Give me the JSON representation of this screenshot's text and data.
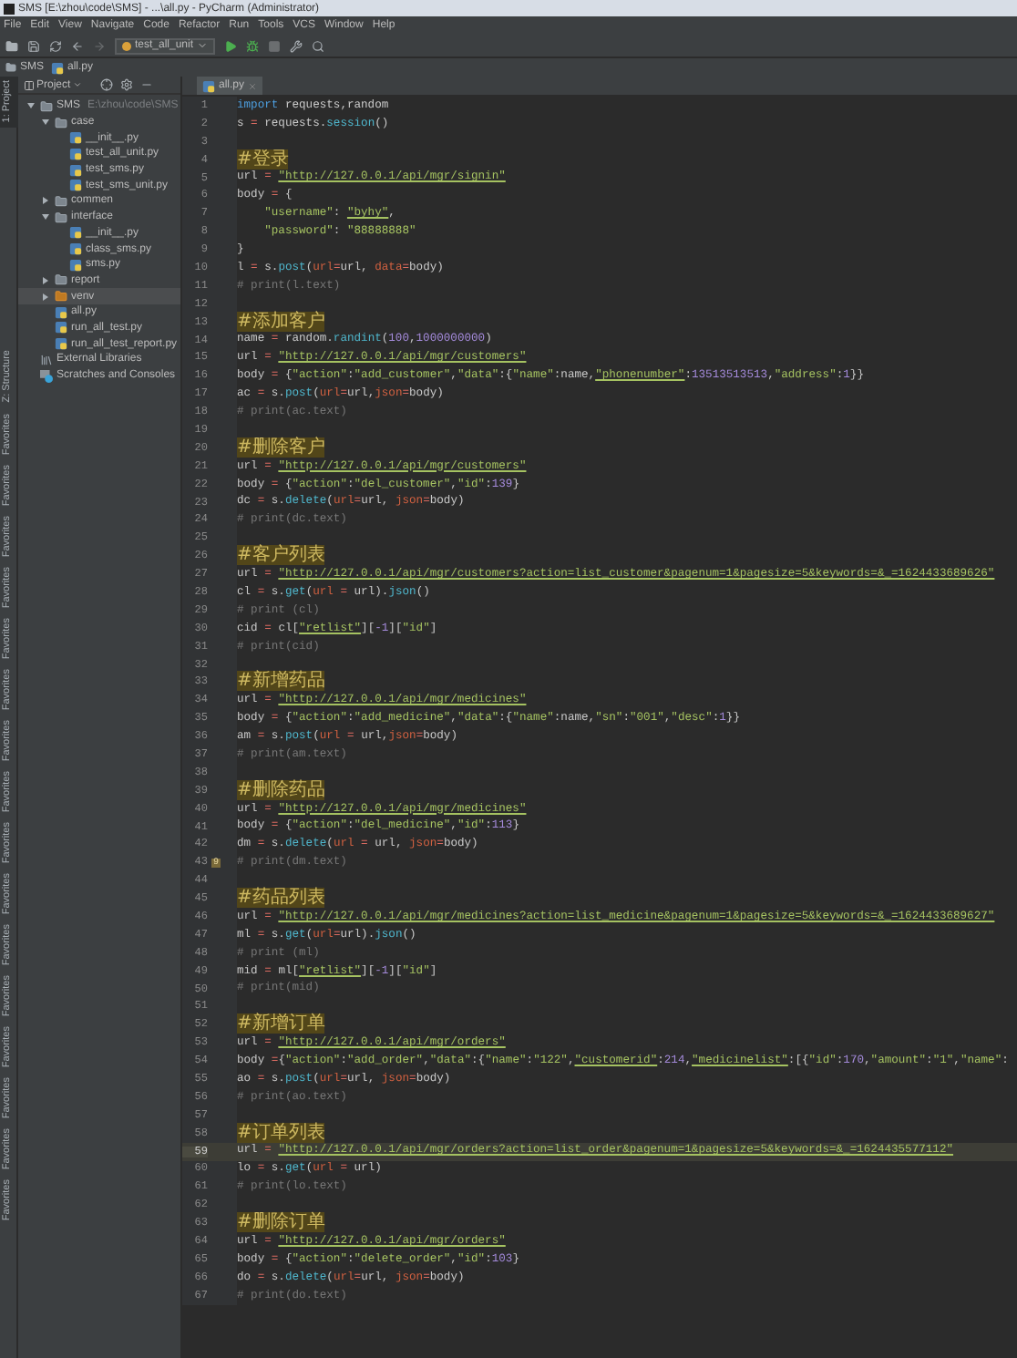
{
  "window": {
    "title": "SMS [E:\\zhou\\code\\SMS] - ...\\all.py - PyCharm (Administrator)"
  },
  "menu": [
    "File",
    "Edit",
    "View",
    "Navigate",
    "Code",
    "Refactor",
    "Run",
    "Tools",
    "VCS",
    "Window",
    "Help"
  ],
  "toolbar": {
    "run_config": "test_all_unit"
  },
  "breadcrumb": [
    "SMS",
    "all.py"
  ],
  "side_strip": [
    {
      "label": "1: Project",
      "selected": true
    },
    {
      "label": "Z: Structure",
      "selected": false
    },
    {
      "label": "Favorites",
      "selected": false
    },
    {
      "label": "Favorites",
      "selected": false
    },
    {
      "label": "Favorites",
      "selected": false
    },
    {
      "label": "Favorites",
      "selected": false
    },
    {
      "label": "Favorites",
      "selected": false
    },
    {
      "label": "Favorites",
      "selected": false
    },
    {
      "label": "Favorites",
      "selected": false
    },
    {
      "label": "Favorites",
      "selected": false
    },
    {
      "label": "Favorites",
      "selected": false
    },
    {
      "label": "Favorites",
      "selected": false
    },
    {
      "label": "Favorites",
      "selected": false
    },
    {
      "label": "Favorites",
      "selected": false
    },
    {
      "label": "Favorites",
      "selected": false
    },
    {
      "label": "Favorites",
      "selected": false
    },
    {
      "label": "Favorites",
      "selected": false
    },
    {
      "label": "Favorites",
      "selected": false
    }
  ],
  "project": {
    "title": "Project",
    "tree": [
      {
        "kind": "folder",
        "label": "SMS",
        "path": "E:\\zhou\\code\\SMS",
        "expanded": true,
        "selected": false,
        "children": [
          {
            "kind": "folder",
            "label": "case",
            "expanded": true,
            "selected": false,
            "children": [
              {
                "kind": "file",
                "label": "__init__.py",
                "selected": false
              },
              {
                "kind": "file",
                "label": "test_all_unit.py",
                "selected": false
              },
              {
                "kind": "file",
                "label": "test_sms.py",
                "selected": false
              },
              {
                "kind": "file",
                "label": "test_sms_unit.py",
                "selected": false
              }
            ]
          },
          {
            "kind": "folder",
            "label": "commen",
            "expanded": false,
            "selected": false
          },
          {
            "kind": "folder",
            "label": "interface",
            "expanded": true,
            "selected": false,
            "children": [
              {
                "kind": "file",
                "label": "__init__.py",
                "selected": false
              },
              {
                "kind": "file",
                "label": "class_sms.py",
                "selected": false
              },
              {
                "kind": "file",
                "label": "sms.py",
                "selected": false
              }
            ]
          },
          {
            "kind": "folder",
            "label": "report",
            "expanded": false,
            "selected": false
          },
          {
            "kind": "venv",
            "label": "venv",
            "expanded": false,
            "selected": true
          },
          {
            "kind": "file",
            "label": "all.py",
            "selected": false
          },
          {
            "kind": "file",
            "label": "run_all_test.py",
            "selected": false
          },
          {
            "kind": "file",
            "label": "run_all_test_report.py",
            "selected": false
          }
        ]
      },
      {
        "kind": "library",
        "label": "External Libraries",
        "selected": false
      },
      {
        "kind": "scratch",
        "label": "Scratches and Consoles",
        "selected": false
      }
    ]
  },
  "editor": {
    "tabs": [
      {
        "label": "all.py",
        "selected": true
      }
    ],
    "lines": [
      {
        "number": "1",
        "current": false,
        "tokens": [
          {
            "kind": "kw",
            "text": "import"
          },
          {
            "kind": "txt",
            "text": " requests,random"
          }
        ]
      },
      {
        "number": "2",
        "current": false,
        "tokens": [
          {
            "kind": "txt",
            "text": "s"
          },
          {
            "kind": "op",
            "text": " = "
          },
          {
            "kind": "txt",
            "text": "requests."
          },
          {
            "kind": "fn",
            "text": "session"
          },
          {
            "kind": "txt",
            "text": "()"
          }
        ]
      },
      {
        "number": "3",
        "current": false
      },
      {
        "number": "4",
        "current": false,
        "tokens": [
          {
            "kind": "head",
            "text": "#登录"
          }
        ]
      },
      {
        "number": "5",
        "current": false,
        "tokens": [
          {
            "kind": "txt",
            "text": "url"
          },
          {
            "kind": "op",
            "text": " = "
          },
          {
            "kind": "url",
            "text": "\"http://127.0.0.1/api/mgr/signin\""
          }
        ]
      },
      {
        "number": "6",
        "current": false,
        "tokens": [
          {
            "kind": "txt",
            "text": "body"
          },
          {
            "kind": "op",
            "text": " = "
          },
          {
            "kind": "txt",
            "text": "{"
          }
        ]
      },
      {
        "number": "7",
        "current": false,
        "tokens": [
          {
            "kind": "str",
            "text": "    \"username\""
          },
          {
            "kind": "txt",
            "text": ": "
          },
          {
            "kind": "url",
            "text": "\"byhy\""
          },
          {
            "kind": "txt",
            "text": ","
          }
        ]
      },
      {
        "number": "8",
        "current": false,
        "tokens": [
          {
            "kind": "str",
            "text": "    \"password\""
          },
          {
            "kind": "txt",
            "text": ": "
          },
          {
            "kind": "str",
            "text": "\"88888888\""
          }
        ]
      },
      {
        "number": "9",
        "current": false,
        "tokens": [
          {
            "kind": "txt",
            "text": "}"
          }
        ]
      },
      {
        "number": "10",
        "current": false,
        "tokens": [
          {
            "kind": "txt",
            "text": "l"
          },
          {
            "kind": "op",
            "text": " = "
          },
          {
            "kind": "txt",
            "text": "s."
          },
          {
            "kind": "fn",
            "text": "post"
          },
          {
            "kind": "txt",
            "text": "("
          },
          {
            "kind": "param",
            "text": "url"
          },
          {
            "kind": "op",
            "text": "="
          },
          {
            "kind": "txt",
            "text": "url, "
          },
          {
            "kind": "param",
            "text": "data"
          },
          {
            "kind": "op",
            "text": "="
          },
          {
            "kind": "txt",
            "text": "body)"
          }
        ]
      },
      {
        "number": "11",
        "current": false,
        "tokens": [
          {
            "kind": "cmt",
            "text": "# print(l.text)"
          }
        ]
      },
      {
        "number": "12",
        "current": false
      },
      {
        "number": "13",
        "current": false,
        "tokens": [
          {
            "kind": "head",
            "text": "#添加客户"
          }
        ]
      },
      {
        "number": "14",
        "current": false,
        "tokens": [
          {
            "kind": "txt",
            "text": "name"
          },
          {
            "kind": "op",
            "text": " = "
          },
          {
            "kind": "txt",
            "text": "random."
          },
          {
            "kind": "fn",
            "text": "randint"
          },
          {
            "kind": "txt",
            "text": "("
          },
          {
            "kind": "num",
            "text": "100"
          },
          {
            "kind": "txt",
            "text": ","
          },
          {
            "kind": "num",
            "text": "1000000000"
          },
          {
            "kind": "txt",
            "text": ")"
          }
        ]
      },
      {
        "number": "15",
        "current": false,
        "tokens": [
          {
            "kind": "txt",
            "text": "url"
          },
          {
            "kind": "op",
            "text": " = "
          },
          {
            "kind": "url",
            "text": "\"http://127.0.0.1/api/mgr/customers\""
          }
        ]
      },
      {
        "number": "16",
        "current": false,
        "tokens": [
          {
            "kind": "txt",
            "text": "body"
          },
          {
            "kind": "op",
            "text": " = "
          },
          {
            "kind": "txt",
            "text": "{"
          },
          {
            "kind": "str",
            "text": "\"action\""
          },
          {
            "kind": "txt",
            "text": ":"
          },
          {
            "kind": "str",
            "text": "\"add_customer\""
          },
          {
            "kind": "txt",
            "text": ","
          },
          {
            "kind": "str",
            "text": "\"data\""
          },
          {
            "kind": "txt",
            "text": ":{"
          },
          {
            "kind": "str",
            "text": "\"name\""
          },
          {
            "kind": "txt",
            "text": ":name,"
          },
          {
            "kind": "url",
            "text": "\"phonenumber\""
          },
          {
            "kind": "txt",
            "text": ":"
          },
          {
            "kind": "num",
            "text": "13513513513"
          },
          {
            "kind": "txt",
            "text": ","
          },
          {
            "kind": "str",
            "text": "\"address\""
          },
          {
            "kind": "txt",
            "text": ":"
          },
          {
            "kind": "num",
            "text": "1"
          },
          {
            "kind": "txt",
            "text": "}}"
          }
        ]
      },
      {
        "number": "17",
        "current": false,
        "tokens": [
          {
            "kind": "txt",
            "text": "ac"
          },
          {
            "kind": "op",
            "text": " = "
          },
          {
            "kind": "txt",
            "text": "s."
          },
          {
            "kind": "fn",
            "text": "post"
          },
          {
            "kind": "txt",
            "text": "("
          },
          {
            "kind": "param",
            "text": "url"
          },
          {
            "kind": "op",
            "text": "="
          },
          {
            "kind": "txt",
            "text": "url,"
          },
          {
            "kind": "param",
            "text": "json"
          },
          {
            "kind": "op",
            "text": "="
          },
          {
            "kind": "txt",
            "text": "body)"
          }
        ]
      },
      {
        "number": "18",
        "current": false,
        "tokens": [
          {
            "kind": "cmt",
            "text": "# print(ac.text)"
          }
        ]
      },
      {
        "number": "19",
        "current": false
      },
      {
        "number": "20",
        "current": false,
        "tokens": [
          {
            "kind": "head",
            "text": "#删除客户"
          }
        ]
      },
      {
        "number": "21",
        "current": false,
        "tokens": [
          {
            "kind": "txt",
            "text": "url"
          },
          {
            "kind": "op",
            "text": " = "
          },
          {
            "kind": "url",
            "text": "\"http://127.0.0.1/api/mgr/customers\""
          }
        ]
      },
      {
        "number": "22",
        "current": false,
        "tokens": [
          {
            "kind": "txt",
            "text": "body"
          },
          {
            "kind": "op",
            "text": " = "
          },
          {
            "kind": "txt",
            "text": "{"
          },
          {
            "kind": "str",
            "text": "\"action\""
          },
          {
            "kind": "txt",
            "text": ":"
          },
          {
            "kind": "str",
            "text": "\"del_customer\""
          },
          {
            "kind": "txt",
            "text": ","
          },
          {
            "kind": "str",
            "text": "\"id\""
          },
          {
            "kind": "txt",
            "text": ":"
          },
          {
            "kind": "num",
            "text": "139"
          },
          {
            "kind": "txt",
            "text": "}"
          }
        ]
      },
      {
        "number": "23",
        "current": false,
        "tokens": [
          {
            "kind": "txt",
            "text": "dc"
          },
          {
            "kind": "op",
            "text": " = "
          },
          {
            "kind": "txt",
            "text": "s."
          },
          {
            "kind": "fn",
            "text": "delete"
          },
          {
            "kind": "txt",
            "text": "("
          },
          {
            "kind": "param",
            "text": "url"
          },
          {
            "kind": "op",
            "text": "="
          },
          {
            "kind": "txt",
            "text": "url, "
          },
          {
            "kind": "param",
            "text": "json"
          },
          {
            "kind": "op",
            "text": "="
          },
          {
            "kind": "txt",
            "text": "body)"
          }
        ]
      },
      {
        "number": "24",
        "current": false,
        "tokens": [
          {
            "kind": "cmt",
            "text": "# print(dc.text)"
          }
        ]
      },
      {
        "number": "25",
        "current": false
      },
      {
        "number": "26",
        "current": false,
        "tokens": [
          {
            "kind": "head",
            "text": "#客户列表"
          }
        ]
      },
      {
        "number": "27",
        "current": false,
        "tokens": [
          {
            "kind": "txt",
            "text": "url"
          },
          {
            "kind": "op",
            "text": " = "
          },
          {
            "kind": "url",
            "text": "\"http://127.0.0.1/api/mgr/customers?action=list_customer&pagenum=1&pagesize=5&keywords=&_=1624433689626\""
          }
        ]
      },
      {
        "number": "28",
        "current": false,
        "tokens": [
          {
            "kind": "txt",
            "text": "cl"
          },
          {
            "kind": "op",
            "text": " = "
          },
          {
            "kind": "txt",
            "text": "s."
          },
          {
            "kind": "fn",
            "text": "get"
          },
          {
            "kind": "txt",
            "text": "("
          },
          {
            "kind": "param",
            "text": "url"
          },
          {
            "kind": "op",
            "text": " = "
          },
          {
            "kind": "txt",
            "text": "url)."
          },
          {
            "kind": "fn",
            "text": "json"
          },
          {
            "kind": "txt",
            "text": "()"
          }
        ]
      },
      {
        "number": "29",
        "current": false,
        "tokens": [
          {
            "kind": "cmt",
            "text": "# print (cl)"
          }
        ]
      },
      {
        "number": "30",
        "current": false,
        "tokens": [
          {
            "kind": "txt",
            "text": "cid"
          },
          {
            "kind": "op",
            "text": " = "
          },
          {
            "kind": "txt",
            "text": "cl["
          },
          {
            "kind": "url",
            "text": "\"retlist\""
          },
          {
            "kind": "txt",
            "text": "]["
          },
          {
            "kind": "num",
            "text": "-1"
          },
          {
            "kind": "txt",
            "text": "]["
          },
          {
            "kind": "str",
            "text": "\"id\""
          },
          {
            "kind": "txt",
            "text": "]"
          }
        ]
      },
      {
        "number": "31",
        "current": false,
        "tokens": [
          {
            "kind": "cmt",
            "text": "# print(cid)"
          }
        ]
      },
      {
        "number": "32",
        "current": false
      },
      {
        "number": "33",
        "current": false,
        "tokens": [
          {
            "kind": "head",
            "text": "#新增药品"
          }
        ]
      },
      {
        "number": "34",
        "current": false,
        "tokens": [
          {
            "kind": "txt",
            "text": "url"
          },
          {
            "kind": "op",
            "text": " = "
          },
          {
            "kind": "url",
            "text": "\"http://127.0.0.1/api/mgr/medicines\""
          }
        ]
      },
      {
        "number": "35",
        "current": false,
        "tokens": [
          {
            "kind": "txt",
            "text": "body"
          },
          {
            "kind": "op",
            "text": " = "
          },
          {
            "kind": "txt",
            "text": "{"
          },
          {
            "kind": "str",
            "text": "\"action\""
          },
          {
            "kind": "txt",
            "text": ":"
          },
          {
            "kind": "str",
            "text": "\"add_medicine\""
          },
          {
            "kind": "txt",
            "text": ","
          },
          {
            "kind": "str",
            "text": "\"data\""
          },
          {
            "kind": "txt",
            "text": ":{"
          },
          {
            "kind": "str",
            "text": "\"name\""
          },
          {
            "kind": "txt",
            "text": ":name,"
          },
          {
            "kind": "str",
            "text": "\"sn\""
          },
          {
            "kind": "txt",
            "text": ":"
          },
          {
            "kind": "str",
            "text": "\"001\""
          },
          {
            "kind": "txt",
            "text": ","
          },
          {
            "kind": "str",
            "text": "\"desc\""
          },
          {
            "kind": "txt",
            "text": ":"
          },
          {
            "kind": "num",
            "text": "1"
          },
          {
            "kind": "txt",
            "text": "}}"
          }
        ]
      },
      {
        "number": "36",
        "current": false,
        "tokens": [
          {
            "kind": "txt",
            "text": "am"
          },
          {
            "kind": "op",
            "text": " = "
          },
          {
            "kind": "txt",
            "text": "s."
          },
          {
            "kind": "fn",
            "text": "post"
          },
          {
            "kind": "txt",
            "text": "("
          },
          {
            "kind": "param",
            "text": "url"
          },
          {
            "kind": "op",
            "text": " = "
          },
          {
            "kind": "txt",
            "text": "url,"
          },
          {
            "kind": "param",
            "text": "json"
          },
          {
            "kind": "op",
            "text": "="
          },
          {
            "kind": "txt",
            "text": "body)"
          }
        ]
      },
      {
        "number": "37",
        "current": false,
        "tokens": [
          {
            "kind": "cmt",
            "text": "# print(am.text)"
          }
        ]
      },
      {
        "number": "38",
        "current": false
      },
      {
        "number": "39",
        "current": false,
        "tokens": [
          {
            "kind": "head",
            "text": "#删除药品"
          }
        ]
      },
      {
        "number": "40",
        "current": false,
        "tokens": [
          {
            "kind": "txt",
            "text": "url"
          },
          {
            "kind": "op",
            "text": " = "
          },
          {
            "kind": "url",
            "text": "\"http://127.0.0.1/api/mgr/medicines\""
          }
        ]
      },
      {
        "number": "41",
        "current": false,
        "tokens": [
          {
            "kind": "txt",
            "text": "body"
          },
          {
            "kind": "op",
            "text": " = "
          },
          {
            "kind": "txt",
            "text": "{"
          },
          {
            "kind": "str",
            "text": "\"action\""
          },
          {
            "kind": "txt",
            "text": ":"
          },
          {
            "kind": "str",
            "text": "\"del_medicine\""
          },
          {
            "kind": "txt",
            "text": ","
          },
          {
            "kind": "str",
            "text": "\"id\""
          },
          {
            "kind": "txt",
            "text": ":"
          },
          {
            "kind": "num",
            "text": "113"
          },
          {
            "kind": "txt",
            "text": "}"
          }
        ]
      },
      {
        "number": "42",
        "current": false,
        "tokens": [
          {
            "kind": "txt",
            "text": "dm"
          },
          {
            "kind": "op",
            "text": " = "
          },
          {
            "kind": "txt",
            "text": "s."
          },
          {
            "kind": "fn",
            "text": "delete"
          },
          {
            "kind": "txt",
            "text": "("
          },
          {
            "kind": "param",
            "text": "url"
          },
          {
            "kind": "op",
            "text": " = "
          },
          {
            "kind": "txt",
            "text": "url, "
          },
          {
            "kind": "param",
            "text": "json"
          },
          {
            "kind": "op",
            "text": "="
          },
          {
            "kind": "txt",
            "text": "body)"
          }
        ]
      },
      {
        "number": "43",
        "current": false,
        "bookmark": "9",
        "tokens": [
          {
            "kind": "cmt",
            "text": "# print(dm.text)"
          }
        ]
      },
      {
        "number": "44",
        "current": false
      },
      {
        "number": "45",
        "current": false,
        "tokens": [
          {
            "kind": "head",
            "text": "#药品列表"
          }
        ]
      },
      {
        "number": "46",
        "current": false,
        "tokens": [
          {
            "kind": "txt",
            "text": "url"
          },
          {
            "kind": "op",
            "text": " = "
          },
          {
            "kind": "url",
            "text": "\"http://127.0.0.1/api/mgr/medicines?action=list_medicine&pagenum=1&pagesize=5&keywords=&_=1624433689627\""
          }
        ]
      },
      {
        "number": "47",
        "current": false,
        "tokens": [
          {
            "kind": "txt",
            "text": "ml"
          },
          {
            "kind": "op",
            "text": " = "
          },
          {
            "kind": "txt",
            "text": "s."
          },
          {
            "kind": "fn",
            "text": "get"
          },
          {
            "kind": "txt",
            "text": "("
          },
          {
            "kind": "param",
            "text": "url"
          },
          {
            "kind": "op",
            "text": "="
          },
          {
            "kind": "txt",
            "text": "url)."
          },
          {
            "kind": "fn",
            "text": "json"
          },
          {
            "kind": "txt",
            "text": "()"
          }
        ]
      },
      {
        "number": "48",
        "current": false,
        "tokens": [
          {
            "kind": "cmt",
            "text": "# print (ml)"
          }
        ]
      },
      {
        "number": "49",
        "current": false,
        "tokens": [
          {
            "kind": "txt",
            "text": "mid"
          },
          {
            "kind": "op",
            "text": " = "
          },
          {
            "kind": "txt",
            "text": "ml["
          },
          {
            "kind": "url",
            "text": "\"retlist\""
          },
          {
            "kind": "txt",
            "text": "]["
          },
          {
            "kind": "num",
            "text": "-1"
          },
          {
            "kind": "txt",
            "text": "]["
          },
          {
            "kind": "str",
            "text": "\"id\""
          },
          {
            "kind": "txt",
            "text": "]"
          }
        ]
      },
      {
        "number": "50",
        "current": false,
        "tokens": [
          {
            "kind": "cmt",
            "text": "# print(mid)"
          }
        ]
      },
      {
        "number": "51",
        "current": false
      },
      {
        "number": "52",
        "current": false,
        "tokens": [
          {
            "kind": "head",
            "text": "#新增订单"
          }
        ]
      },
      {
        "number": "53",
        "current": false,
        "tokens": [
          {
            "kind": "txt",
            "text": "url"
          },
          {
            "kind": "op",
            "text": " = "
          },
          {
            "kind": "url",
            "text": "\"http://127.0.0.1/api/mgr/orders\""
          }
        ]
      },
      {
        "number": "54",
        "current": false,
        "tokens": [
          {
            "kind": "txt",
            "text": "body"
          },
          {
            "kind": "op",
            "text": " ="
          },
          {
            "kind": "txt",
            "text": "{"
          },
          {
            "kind": "str",
            "text": "\"action\""
          },
          {
            "kind": "txt",
            "text": ":"
          },
          {
            "kind": "str",
            "text": "\"add_order\""
          },
          {
            "kind": "txt",
            "text": ","
          },
          {
            "kind": "str",
            "text": "\"data\""
          },
          {
            "kind": "txt",
            "text": ":{"
          },
          {
            "kind": "str",
            "text": "\"name\""
          },
          {
            "kind": "txt",
            "text": ":"
          },
          {
            "kind": "str",
            "text": "\"122\""
          },
          {
            "kind": "txt",
            "text": ","
          },
          {
            "kind": "url",
            "text": "\"customerid\""
          },
          {
            "kind": "txt",
            "text": ":"
          },
          {
            "kind": "num",
            "text": "214"
          },
          {
            "kind": "txt",
            "text": ","
          },
          {
            "kind": "url",
            "text": "\"medicinelist\""
          },
          {
            "kind": "txt",
            "text": ":[{"
          },
          {
            "kind": "str",
            "text": "\"id\""
          },
          {
            "kind": "txt",
            "text": ":"
          },
          {
            "kind": "num",
            "text": "170"
          },
          {
            "kind": "txt",
            "text": ","
          },
          {
            "kind": "str",
            "text": "\"amount\""
          },
          {
            "kind": "txt",
            "text": ":"
          },
          {
            "kind": "str",
            "text": "\"1\""
          },
          {
            "kind": "txt",
            "text": ","
          },
          {
            "kind": "str",
            "text": "\"name\""
          },
          {
            "kind": "txt",
            "text": ":"
          }
        ]
      },
      {
        "number": "55",
        "current": false,
        "tokens": [
          {
            "kind": "txt",
            "text": "ao"
          },
          {
            "kind": "op",
            "text": " = "
          },
          {
            "kind": "txt",
            "text": "s."
          },
          {
            "kind": "fn",
            "text": "post"
          },
          {
            "kind": "txt",
            "text": "("
          },
          {
            "kind": "param",
            "text": "url"
          },
          {
            "kind": "op",
            "text": "="
          },
          {
            "kind": "txt",
            "text": "url, "
          },
          {
            "kind": "param",
            "text": "json"
          },
          {
            "kind": "op",
            "text": "="
          },
          {
            "kind": "txt",
            "text": "body)"
          }
        ]
      },
      {
        "number": "56",
        "current": false,
        "tokens": [
          {
            "kind": "cmt",
            "text": "# print(ao.text)"
          }
        ]
      },
      {
        "number": "57",
        "current": false
      },
      {
        "number": "58",
        "current": false,
        "tokens": [
          {
            "kind": "head",
            "text": "#订单列表"
          }
        ]
      },
      {
        "number": "59",
        "current": true,
        "tokens": [
          {
            "kind": "txt",
            "text": "url"
          },
          {
            "kind": "op",
            "text": " = "
          },
          {
            "kind": "url",
            "text": "\"http://127.0.0.1/api/mgr/orders?action=list_order&pagenum=1&pagesize=5&keywords=&_=1624435577112\""
          }
        ]
      },
      {
        "number": "60",
        "current": false,
        "tokens": [
          {
            "kind": "txt",
            "text": "lo"
          },
          {
            "kind": "op",
            "text": " = "
          },
          {
            "kind": "txt",
            "text": "s."
          },
          {
            "kind": "fn",
            "text": "get"
          },
          {
            "kind": "txt",
            "text": "("
          },
          {
            "kind": "param",
            "text": "url"
          },
          {
            "kind": "op",
            "text": " = "
          },
          {
            "kind": "txt",
            "text": "url)"
          }
        ]
      },
      {
        "number": "61",
        "current": false,
        "tokens": [
          {
            "kind": "cmt",
            "text": "# print(lo.text)"
          }
        ]
      },
      {
        "number": "62",
        "current": false
      },
      {
        "number": "63",
        "current": false,
        "tokens": [
          {
            "kind": "head",
            "text": "#删除订单"
          }
        ]
      },
      {
        "number": "64",
        "current": false,
        "tokens": [
          {
            "kind": "txt",
            "text": "url"
          },
          {
            "kind": "op",
            "text": " = "
          },
          {
            "kind": "url",
            "text": "\"http://127.0.0.1/api/mgr/orders\""
          }
        ]
      },
      {
        "number": "65",
        "current": false,
        "tokens": [
          {
            "kind": "txt",
            "text": "body"
          },
          {
            "kind": "op",
            "text": " = "
          },
          {
            "kind": "txt",
            "text": "{"
          },
          {
            "kind": "str",
            "text": "\"action\""
          },
          {
            "kind": "txt",
            "text": ":"
          },
          {
            "kind": "str",
            "text": "\"delete_order\""
          },
          {
            "kind": "txt",
            "text": ","
          },
          {
            "kind": "str",
            "text": "\"id\""
          },
          {
            "kind": "txt",
            "text": ":"
          },
          {
            "kind": "num",
            "text": "103"
          },
          {
            "kind": "txt",
            "text": "}"
          }
        ]
      },
      {
        "number": "66",
        "current": false,
        "tokens": [
          {
            "kind": "txt",
            "text": "do"
          },
          {
            "kind": "op",
            "text": " = "
          },
          {
            "kind": "txt",
            "text": "s."
          },
          {
            "kind": "fn",
            "text": "delete"
          },
          {
            "kind": "txt",
            "text": "("
          },
          {
            "kind": "param",
            "text": "url"
          },
          {
            "kind": "op",
            "text": "="
          },
          {
            "kind": "txt",
            "text": "url, "
          },
          {
            "kind": "param",
            "text": "json"
          },
          {
            "kind": "op",
            "text": "="
          },
          {
            "kind": "txt",
            "text": "body)"
          }
        ]
      },
      {
        "number": "67",
        "current": false,
        "tokens": [
          {
            "kind": "cmt",
            "text": "# print(do.text)"
          }
        ]
      }
    ]
  }
}
